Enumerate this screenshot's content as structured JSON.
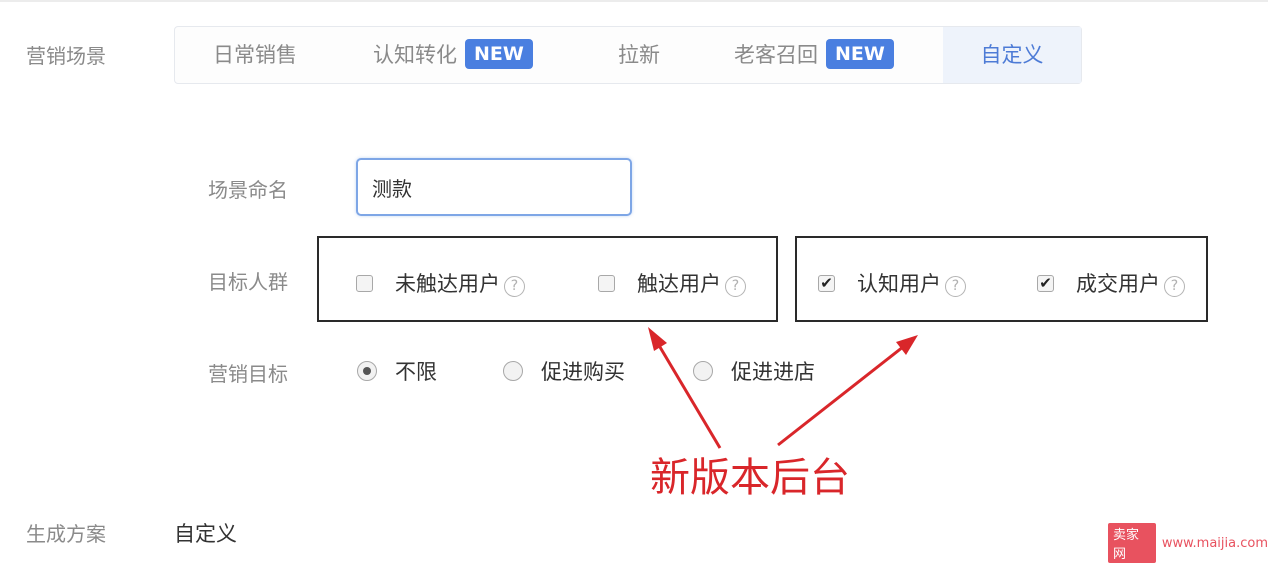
{
  "scene": {
    "label": "营销场景",
    "tabs": [
      {
        "label": "日常销售",
        "badge": null
      },
      {
        "label": "认知转化",
        "badge": "NEW"
      },
      {
        "label": "拉新",
        "badge": null
      },
      {
        "label": "老客召回",
        "badge": "NEW"
      },
      {
        "label": "自定义",
        "badge": null,
        "active": true
      }
    ]
  },
  "form": {
    "name_label": "场景命名",
    "name_value": "测款",
    "audience_label": "目标人群",
    "audience": [
      {
        "label": "未触达用户",
        "checked": false,
        "help": "?"
      },
      {
        "label": "触达用户",
        "checked": false,
        "help": "?"
      },
      {
        "label": "认知用户",
        "checked": true,
        "help": "?"
      },
      {
        "label": "成交用户",
        "checked": true,
        "help": "?"
      }
    ],
    "goal_label": "营销目标",
    "goals": [
      {
        "label": "不限",
        "selected": true
      },
      {
        "label": "促进购买",
        "selected": false
      },
      {
        "label": "促进进店",
        "selected": false
      }
    ]
  },
  "annotation": {
    "text": "新版本后台",
    "color": "#d9262a"
  },
  "footer": {
    "label": "生成方案",
    "value": "自定义"
  },
  "watermark": {
    "badge": "卖家网",
    "url": "www.maijia.com"
  },
  "colors": {
    "accent": "#4a7fe0",
    "annotation": "#d9262a"
  }
}
